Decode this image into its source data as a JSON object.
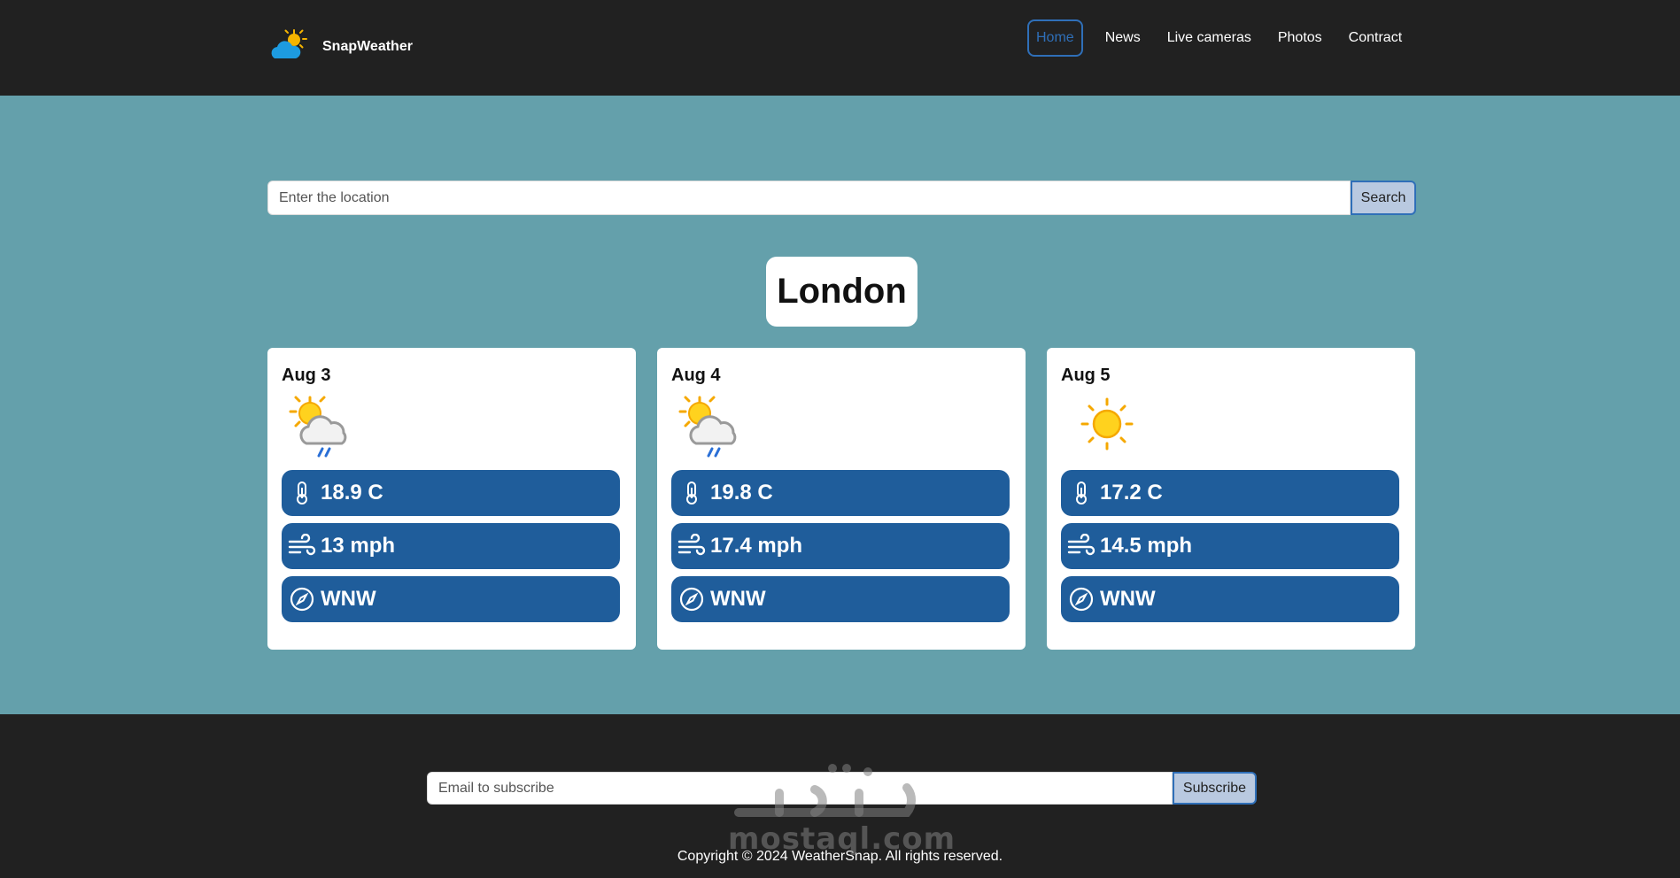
{
  "brand": {
    "name": "SnapWeather",
    "logo_icon": "sun-cloud-icon"
  },
  "nav": {
    "items": [
      {
        "label": "Home",
        "active": true
      },
      {
        "label": "News",
        "active": false
      },
      {
        "label": "Live cameras",
        "active": false
      },
      {
        "label": "Photos",
        "active": false
      },
      {
        "label": "Contract",
        "active": false
      }
    ]
  },
  "search": {
    "placeholder": "Enter the location",
    "value": "",
    "button_label": "Search"
  },
  "location": {
    "city": "London"
  },
  "forecast": [
    {
      "date": "Aug 3",
      "condition_icon": "sun-cloud-rain-icon",
      "temperature": "18.9 C",
      "wind_speed": "13 mph",
      "wind_direction": "WNW"
    },
    {
      "date": "Aug 4",
      "condition_icon": "sun-cloud-rain-icon",
      "temperature": "19.8 C",
      "wind_speed": "17.4 mph",
      "wind_direction": "WNW"
    },
    {
      "date": "Aug 5",
      "condition_icon": "sun-icon",
      "temperature": "17.2 C",
      "wind_speed": "14.5 mph",
      "wind_direction": "WNW"
    }
  ],
  "subscribe": {
    "placeholder": "Email to subscribe",
    "value": "",
    "button_label": "Subscribe"
  },
  "footer": {
    "copyright": "Copyright © 2024 WeatherSnap. All rights reserved."
  },
  "watermark": {
    "text": "mostaql.com"
  },
  "colors": {
    "header_bg": "#212121",
    "main_bg": "#64a0ab",
    "pill_bg": "#1f5d9b",
    "accent": "#2f6fb8",
    "button_bg": "#b9c9e0"
  }
}
